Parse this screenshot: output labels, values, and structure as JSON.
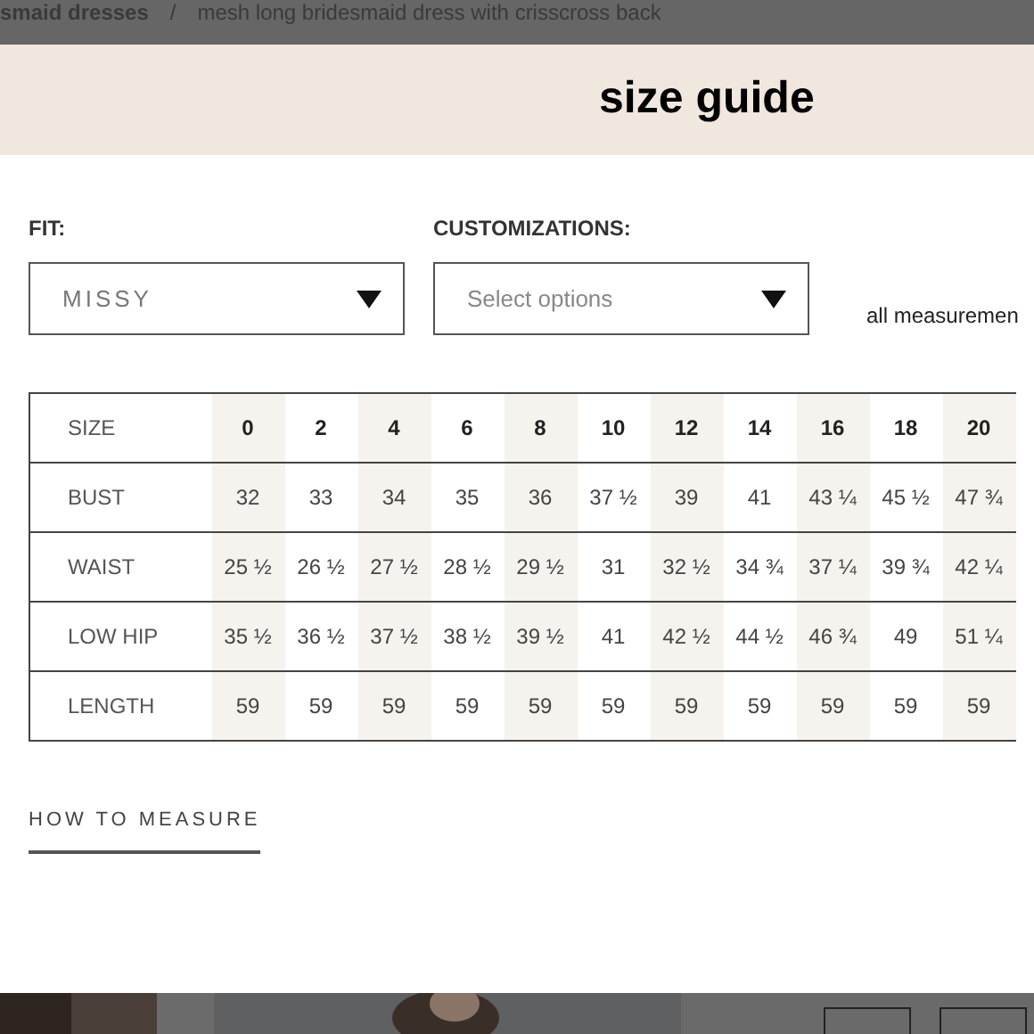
{
  "breadcrumb": [
    "smaid dresses",
    "/",
    "mesh long bridesmaid dress with crisscross back"
  ],
  "title": "size guide",
  "fit": {
    "label": "FIT:",
    "value": "MISSY"
  },
  "customizations": {
    "label": "CUSTOMIZATIONS:",
    "placeholder": "Select options"
  },
  "note": "all measuremen",
  "table": {
    "columns": [
      "SIZE",
      "0",
      "2",
      "4",
      "6",
      "8",
      "10",
      "12",
      "14",
      "16",
      "18",
      "20"
    ],
    "rows": [
      [
        "BUST",
        "32",
        "33",
        "34",
        "35",
        "36",
        "37 ½",
        "39",
        "41",
        "43 ¼",
        "45 ½",
        "47 ¾"
      ],
      [
        "WAIST",
        "25 ½",
        "26 ½",
        "27 ½",
        "28 ½",
        "29 ½",
        "31",
        "32 ½",
        "34 ¾",
        "37 ¼",
        "39 ¾",
        "42 ¼"
      ],
      [
        "LOW HIP",
        "35 ½",
        "36 ½",
        "37 ½",
        "38 ½",
        "39 ½",
        "41",
        "42 ½",
        "44 ½",
        "46 ¾",
        "49",
        "51 ¼"
      ],
      [
        "LENGTH",
        "59",
        "59",
        "59",
        "59",
        "59",
        "59",
        "59",
        "59",
        "59",
        "59",
        "59"
      ]
    ]
  },
  "how_to_measure": "HOW TO MEASURE"
}
